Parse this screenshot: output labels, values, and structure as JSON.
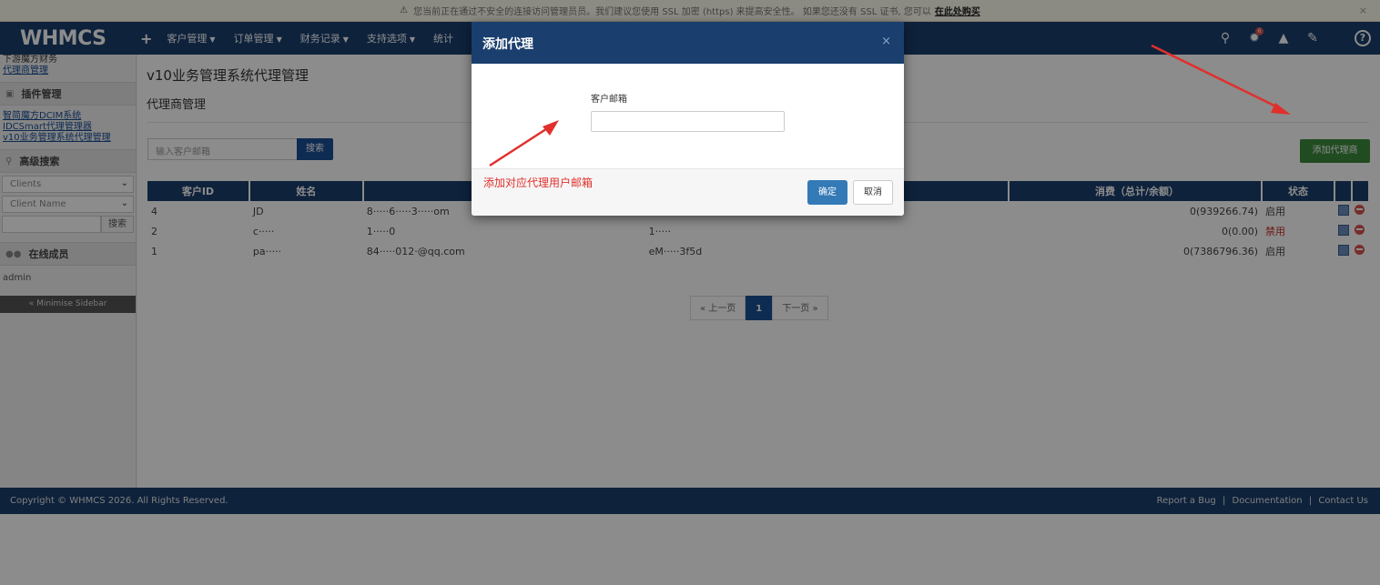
{
  "warning": {
    "text": "您当前正在通过不安全的连接访问管理员员。我们建议您使用 SSL 加密 (https) 来提高安全性。 如果您还没有 SSL 证书, 您可以",
    "link": "在此处购买",
    "close": "×"
  },
  "nav": {
    "logo": "WHMCS",
    "plus": "+",
    "items": [
      "客户管理",
      "订单管理",
      "财务记录",
      "支持选项",
      "统计"
    ],
    "notification_count": "6"
  },
  "sidebar": {
    "links": [
      "下游魔方财务",
      "代理商管理"
    ],
    "plugins_heading": "插件管理",
    "plugin_links": [
      "智简魔方DCIM系统",
      "IDCSmart代理管理器",
      "v10业务管理系统代理管理"
    ],
    "advanced_search_heading": "高级搜索",
    "select1": "Clients",
    "select2": "Client Name",
    "search_button": "搜索",
    "online_heading": "在线成员",
    "online_user": "admin",
    "minimise": "« Minimise Sidebar"
  },
  "main": {
    "page_title": "v10业务管理系统代理管理",
    "sub_title": "代理商管理",
    "search_placeholder": "输入客户邮箱",
    "search_button": "搜索",
    "add_button": "添加代理商",
    "columns": [
      "客户ID",
      "姓名",
      "",
      "",
      "消费（总计/余额）",
      "状态",
      "",
      ""
    ],
    "rows": [
      {
        "id": "4",
        "name": "JD",
        "email": "8·····6·····3·····om",
        "key": "",
        "spend": "0(939266.74)",
        "status": "启用"
      },
      {
        "id": "2",
        "name": "c·····",
        "email": "1·····0",
        "key": "1·····",
        "spend": "0(0.00)",
        "status": "禁用"
      },
      {
        "id": "1",
        "name": "pa·····",
        "email": "84·····012·@qq.com",
        "key": "eM·····3f5d",
        "spend": "0(7386796.36)",
        "status": "启用"
      }
    ],
    "pager": {
      "prev": "« 上一页",
      "current": "1",
      "next": "下一页 »"
    }
  },
  "footer": {
    "copyright": "Copyright © WHMCS 2026. All Rights Reserved.",
    "links": [
      "Report a Bug",
      "Documentation",
      "Contact Us"
    ],
    "sep": "|"
  },
  "modal": {
    "title": "添加代理",
    "close": "×",
    "email_label": "客户邮箱",
    "email_value": "",
    "confirm": "确定",
    "cancel": "取消",
    "annotation": "添加对应代理用户邮箱"
  },
  "colors": {
    "nav": "#1a3e6e",
    "primary": "#337ab7",
    "success": "#3c8a3c",
    "annotation": "#e0302c"
  }
}
